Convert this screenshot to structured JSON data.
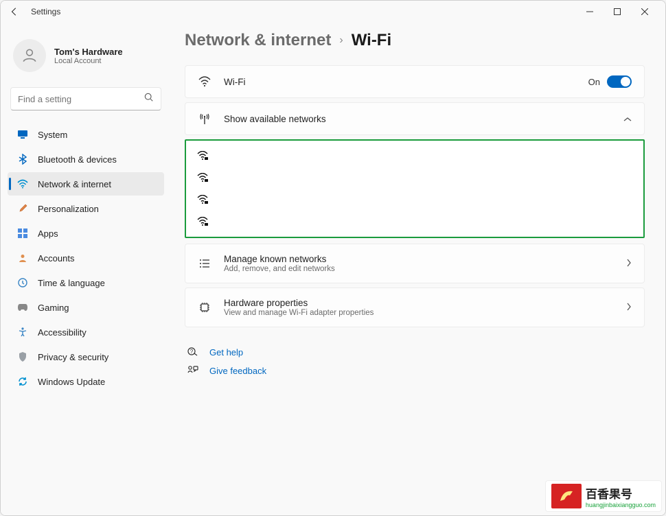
{
  "window": {
    "title": "Settings"
  },
  "user": {
    "name": "Tom's Hardware",
    "account_type": "Local Account"
  },
  "search": {
    "placeholder": "Find a setting"
  },
  "nav": {
    "items": [
      {
        "label": "System"
      },
      {
        "label": "Bluetooth & devices"
      },
      {
        "label": "Network & internet"
      },
      {
        "label": "Personalization"
      },
      {
        "label": "Apps"
      },
      {
        "label": "Accounts"
      },
      {
        "label": "Time & language"
      },
      {
        "label": "Gaming"
      },
      {
        "label": "Accessibility"
      },
      {
        "label": "Privacy & security"
      },
      {
        "label": "Windows Update"
      }
    ],
    "selected_index": 2
  },
  "breadcrumb": {
    "parent": "Network & internet",
    "current": "Wi-Fi"
  },
  "wifi_row": {
    "title": "Wi-Fi",
    "state_label": "On",
    "enabled": true
  },
  "available": {
    "title": "Show available networks"
  },
  "networks": [
    {
      "name": ""
    },
    {
      "name": ""
    },
    {
      "name": ""
    },
    {
      "name": ""
    }
  ],
  "known": {
    "title": "Manage known networks",
    "sub": "Add, remove, and edit networks"
  },
  "hardware": {
    "title": "Hardware properties",
    "sub": "View and manage Wi-Fi adapter properties"
  },
  "help": {
    "get_help": "Get help",
    "feedback": "Give feedback"
  },
  "watermark": {
    "title": "百香果号",
    "url": "huangjinbaixiangguo.com"
  }
}
